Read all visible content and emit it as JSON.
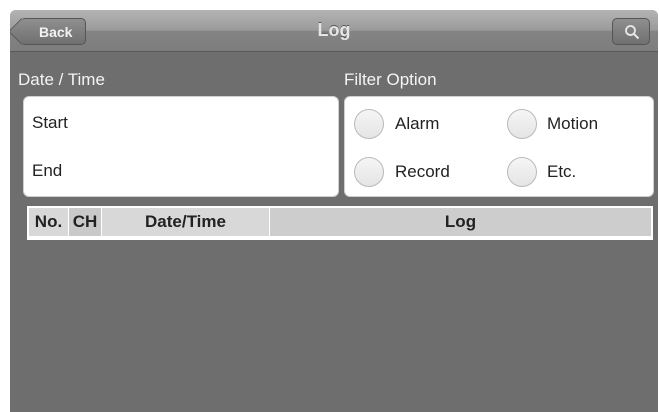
{
  "navbar": {
    "back_label": "Back",
    "title": "Log",
    "search_icon": "magnifier-icon"
  },
  "date_time": {
    "heading": "Date / Time",
    "start_label": "Start",
    "end_label": "End"
  },
  "filter": {
    "heading": "Filter Option",
    "options": [
      {
        "label": "Alarm"
      },
      {
        "label": "Motion"
      },
      {
        "label": "Record"
      },
      {
        "label": "Etc."
      }
    ]
  },
  "table": {
    "columns": [
      "No.",
      "CH",
      "Date/Time",
      "Log"
    ],
    "rows": []
  },
  "colors": {
    "background": "#6e6e6e",
    "navbar": "#9a9a9a",
    "table_header": "#d8d8d8"
  }
}
